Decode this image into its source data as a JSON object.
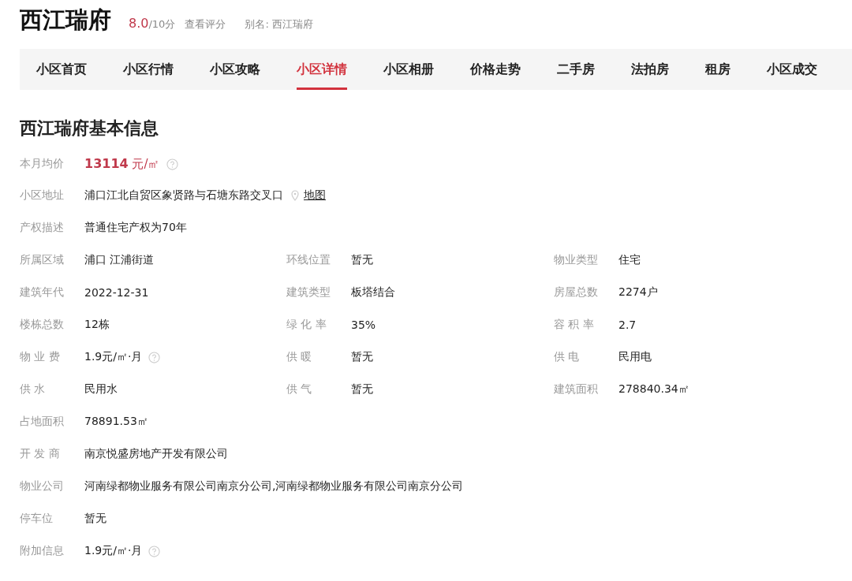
{
  "header": {
    "title": "西江瑞府",
    "score": "8.0",
    "score_max": "/10分",
    "rating_link": "查看评分",
    "alias_label": "别名:",
    "alias": "西江瑞府"
  },
  "tabs": [
    {
      "label": "小区首页",
      "selected": false
    },
    {
      "label": "小区行情",
      "selected": false
    },
    {
      "label": "小区攻略",
      "selected": false
    },
    {
      "label": "小区详情",
      "selected": true
    },
    {
      "label": "小区相册",
      "selected": false
    },
    {
      "label": "价格走势",
      "selected": false
    },
    {
      "label": "二手房",
      "selected": false
    },
    {
      "label": "法拍房",
      "selected": false
    },
    {
      "label": "租房",
      "selected": false
    },
    {
      "label": "小区成交",
      "selected": false
    }
  ],
  "section_title": "西江瑞府基本信息",
  "rows": [
    [
      {
        "label": "本月均价",
        "value": "**13114** 元/㎡",
        "kind": "price",
        "help": true
      }
    ],
    [
      {
        "label": "小区地址",
        "value": "浦口江北自贸区象贤路与石塘东路交叉口",
        "kind": "plain",
        "help": false,
        "map_link": "地图"
      }
    ],
    [
      {
        "label": "产权描述",
        "value": "普通住宅产权为70年",
        "kind": "plain",
        "help": false
      }
    ],
    [
      {
        "label": "所属区域",
        "value": "浦口 江浦街道",
        "kind": "plain",
        "help": false
      },
      {
        "label": "环线位置",
        "value": "暂无",
        "kind": "plain",
        "help": false
      },
      {
        "label": "物业类型",
        "value": "住宅",
        "kind": "plain",
        "help": false
      }
    ],
    [
      {
        "label": "建筑年代",
        "value": "2022-12-31",
        "kind": "plain",
        "help": false
      },
      {
        "label": "建筑类型",
        "value": "板塔结合",
        "kind": "plain",
        "help": false
      },
      {
        "label": "房屋总数",
        "value": "2274户",
        "kind": "plain",
        "help": false
      }
    ],
    [
      {
        "label": "楼栋总数",
        "value": "12栋",
        "kind": "plain",
        "help": false
      },
      {
        "label": "绿 化 率",
        "value": "35%",
        "kind": "plain",
        "help": false
      },
      {
        "label": "容 积 率",
        "value": "2.7",
        "kind": "plain",
        "help": false
      }
    ],
    [
      {
        "label": "物 业 费",
        "value": "1.9元/㎡·月",
        "kind": "plain",
        "help": true
      },
      {
        "label": "供 暖",
        "value": "暂无",
        "kind": "plain",
        "help": false
      },
      {
        "label": "供 电",
        "value": "民用电",
        "kind": "plain",
        "help": false
      }
    ],
    [
      {
        "label": "供 水",
        "value": "民用水",
        "kind": "plain",
        "help": false
      },
      {
        "label": "供 气",
        "value": "暂无",
        "kind": "plain",
        "help": false
      },
      {
        "label": "建筑面积",
        "value": "278840.34㎡",
        "kind": "plain",
        "help": false
      }
    ],
    [
      {
        "label": "占地面积",
        "value": "78891.53㎡",
        "kind": "plain",
        "help": false
      }
    ],
    [
      {
        "label": "开 发 商",
        "value": "南京悦盛房地产开发有限公司",
        "kind": "plain",
        "help": false
      }
    ],
    [
      {
        "label": "物业公司",
        "value": "河南绿都物业服务有限公司南京分公司,河南绿都物业服务有限公司南京分公司",
        "kind": "plain",
        "help": false
      }
    ],
    [
      {
        "label": "停车位",
        "value": "暂无",
        "kind": "plain",
        "help": false
      }
    ],
    [
      {
        "label": "附加信息",
        "value": "1.9元/㎡·月",
        "kind": "plain",
        "help": true
      }
    ]
  ]
}
